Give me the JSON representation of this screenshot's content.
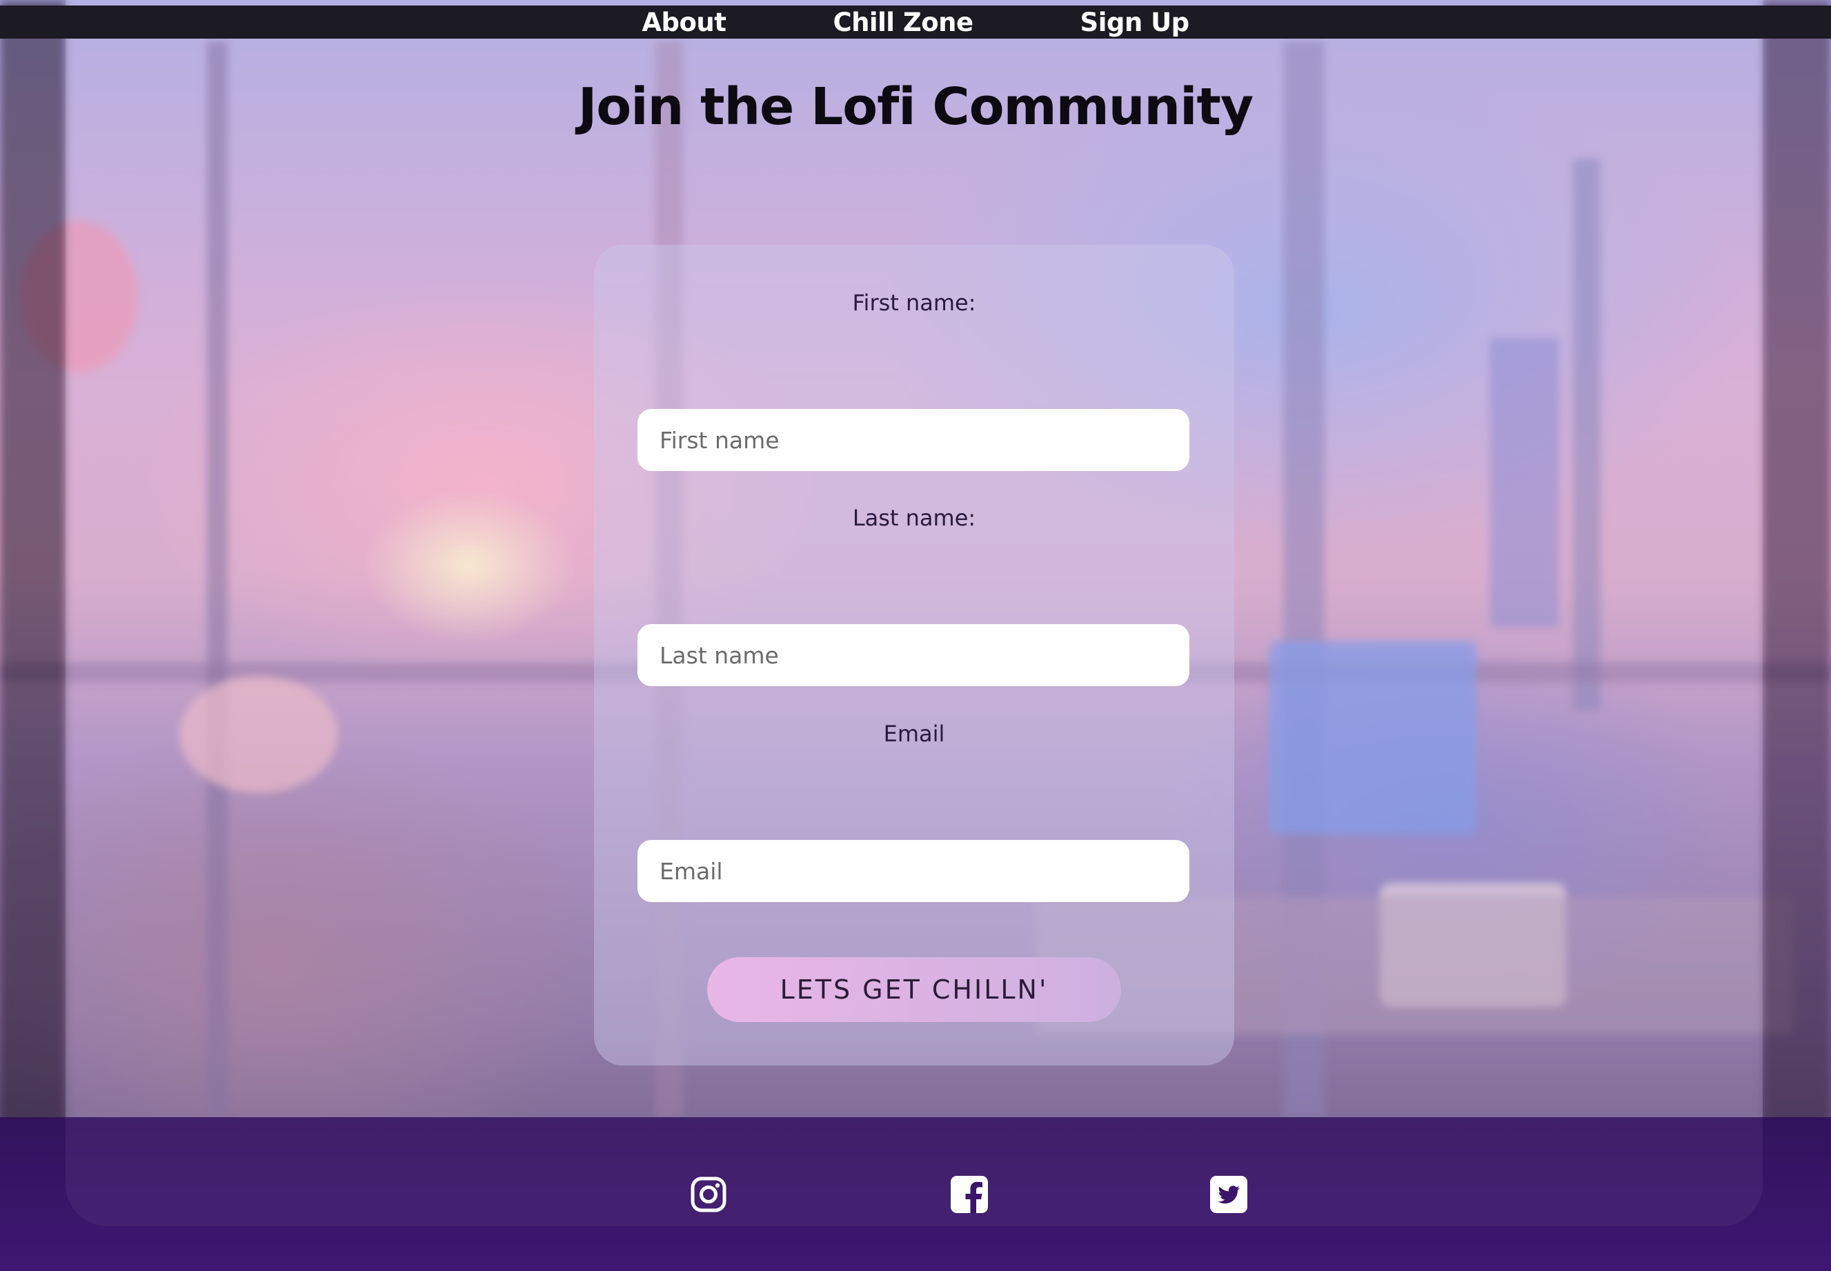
{
  "nav": {
    "about": "About",
    "chill_zone": "Chill Zone",
    "sign_up": "Sign Up"
  },
  "page_title": "Join the Lofi Community",
  "form": {
    "first_name_label": "First name:",
    "first_name_placeholder": "First name",
    "first_name_value": "",
    "last_name_label": "Last name:",
    "last_name_placeholder": "Last name",
    "last_name_value": "",
    "email_label": "Email",
    "email_placeholder": "Email",
    "email_value": "",
    "submit_label": "LETS GET CHILLN'"
  },
  "footer": {
    "icons": [
      "instagram-icon",
      "facebook-icon",
      "twitter-icon"
    ]
  },
  "colors": {
    "nav_bg": "#1c1a22",
    "footer_bg": "#3a156a",
    "button_gradient_start": "#e9b6e6",
    "button_gradient_end": "#cdb0df",
    "title_text": "#0d0a12"
  }
}
